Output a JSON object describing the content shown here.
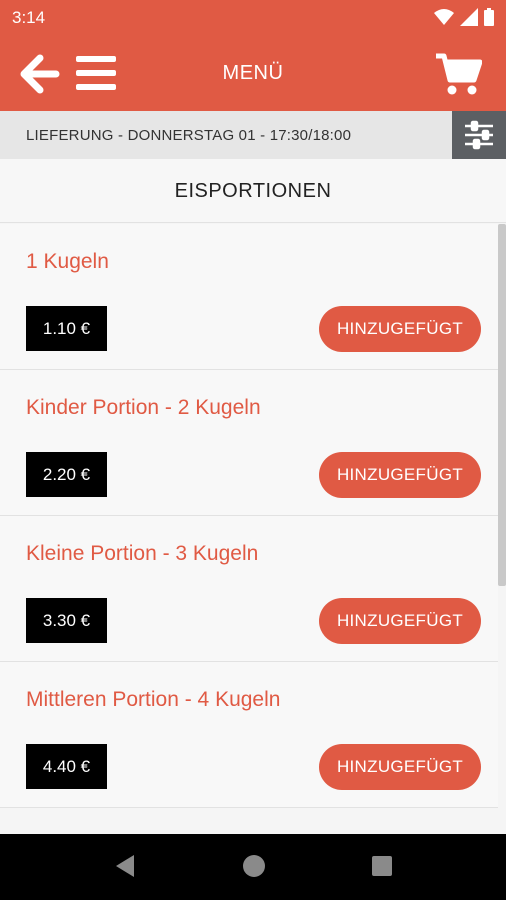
{
  "status": {
    "time": "3:14"
  },
  "app_bar": {
    "title": "MENÜ"
  },
  "delivery": {
    "text": "LIEFERUNG - DONNERSTAG 01 - 17:30/18:00"
  },
  "section": {
    "title": "EISPORTIONEN"
  },
  "items": [
    {
      "name": "1 Kugeln",
      "price": "1.10 €",
      "button": "HINZUGEFÜGT"
    },
    {
      "name": "Kinder Portion - 2 Kugeln",
      "price": "2.20 €",
      "button": "HINZUGEFÜGT"
    },
    {
      "name": "Kleine Portion - 3 Kugeln",
      "price": "3.30 €",
      "button": "HINZUGEFÜGT"
    },
    {
      "name": "Mittleren Portion - 4 Kugeln",
      "price": "4.40 €",
      "button": "HINZUGEFÜGT"
    }
  ],
  "colors": {
    "accent": "#e05a44",
    "filter_bg": "#5c5f63",
    "price_bg": "#000000"
  },
  "icons": [
    "wifi-icon",
    "signal-icon",
    "battery-icon",
    "back-arrow-icon",
    "hamburger-icon",
    "cart-icon",
    "filter-sliders-icon",
    "nav-back-icon",
    "nav-home-icon",
    "nav-recents-icon"
  ]
}
